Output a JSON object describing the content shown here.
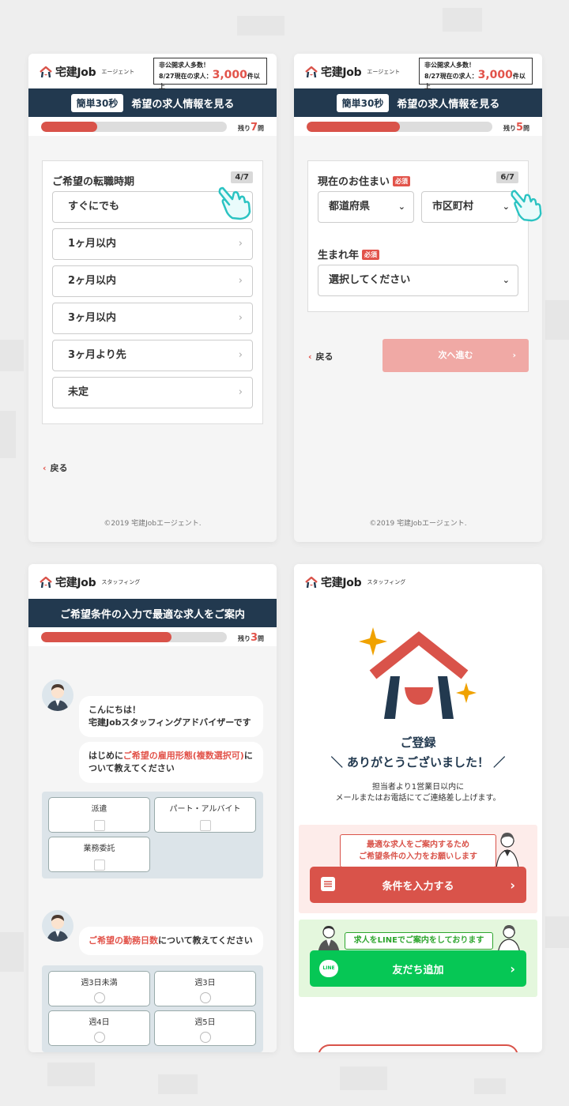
{
  "brand": {
    "logo_main": "宅建Job",
    "sub_agent": "エージェント",
    "sub_staffing": "スタッフィング"
  },
  "header_badge": {
    "line1": "非公開求人多数！",
    "line2_prefix": "8/27現在の求人：",
    "count": "3,000",
    "suffix": "件以上"
  },
  "screen1": {
    "bar_pill": "簡単30秒",
    "bar_title": "希望の求人情報を見る",
    "progress_percent": 30,
    "remaining_prefix": "残り",
    "remaining_num": "7",
    "remaining_suffix": "問",
    "question": "ご希望の転職時期",
    "step": "4/7",
    "options": [
      "すぐにでも",
      "1ヶ月以内",
      "2ヶ月以内",
      "3ヶ月以内",
      "3ヶ月より先",
      "未定"
    ],
    "back": "戻る",
    "copyright": "©2019 宅建Jobエージェント."
  },
  "screen2": {
    "bar_pill": "簡単30秒",
    "bar_title": "希望の求人情報を見る",
    "progress_percent": 50,
    "remaining_prefix": "残り",
    "remaining_num": "5",
    "remaining_suffix": "問",
    "question_address": "現在のお住まい",
    "required": "必須",
    "step": "6/7",
    "prefecture_placeholder": "都道府県",
    "city_placeholder": "市区町村",
    "question_birth": "生まれ年",
    "birth_placeholder": "選択してください",
    "back": "戻る",
    "next": "次へ進む",
    "copyright": "©2019 宅建Jobエージェント."
  },
  "screen3": {
    "bar_title": "ご希望条件の入力で最適な求人をご案内",
    "progress_percent": 70,
    "remaining_prefix": "残り",
    "remaining_num": "3",
    "remaining_suffix": "問",
    "bubble1_line1": "こんにちは！",
    "bubble1_line2": "宅建Jobスタッフィングアドバイザーです",
    "bubble2_pre": "はじめに",
    "bubble2_red": "ご希望の雇用形態(複数選択可)",
    "bubble2_post": "に",
    "bubble2_line2": "ついて教えてください",
    "employment_options": [
      "派遣",
      "パート・アルバイト",
      "業務委託"
    ],
    "bubble3_red": "ご希望の勤務日数",
    "bubble3_post": "について教えてください",
    "days_options": [
      "週3日未満",
      "週3日",
      "週4日",
      "週5日"
    ]
  },
  "screen4": {
    "title": "ご登録",
    "thanks": "ありがとうございました！",
    "desc_line1": "担当者より1営業日以内に",
    "desc_line2": "メールまたはお電話にてご連絡差し上げます。",
    "pink_line1": "最適な求人をご案内するため",
    "pink_line2": "ご希望条件の入力をお願いします",
    "input_button": "条件を入力する",
    "line_banner": "求人をLINEでご案内をしております",
    "line_button": "友だち追加",
    "line_icon_text": "LINE"
  },
  "colors": {
    "navy": "#22394f",
    "red": "#d9534a",
    "line_green": "#06c755",
    "accent_teal": "#2bc3c2",
    "star": "#f0a200"
  }
}
